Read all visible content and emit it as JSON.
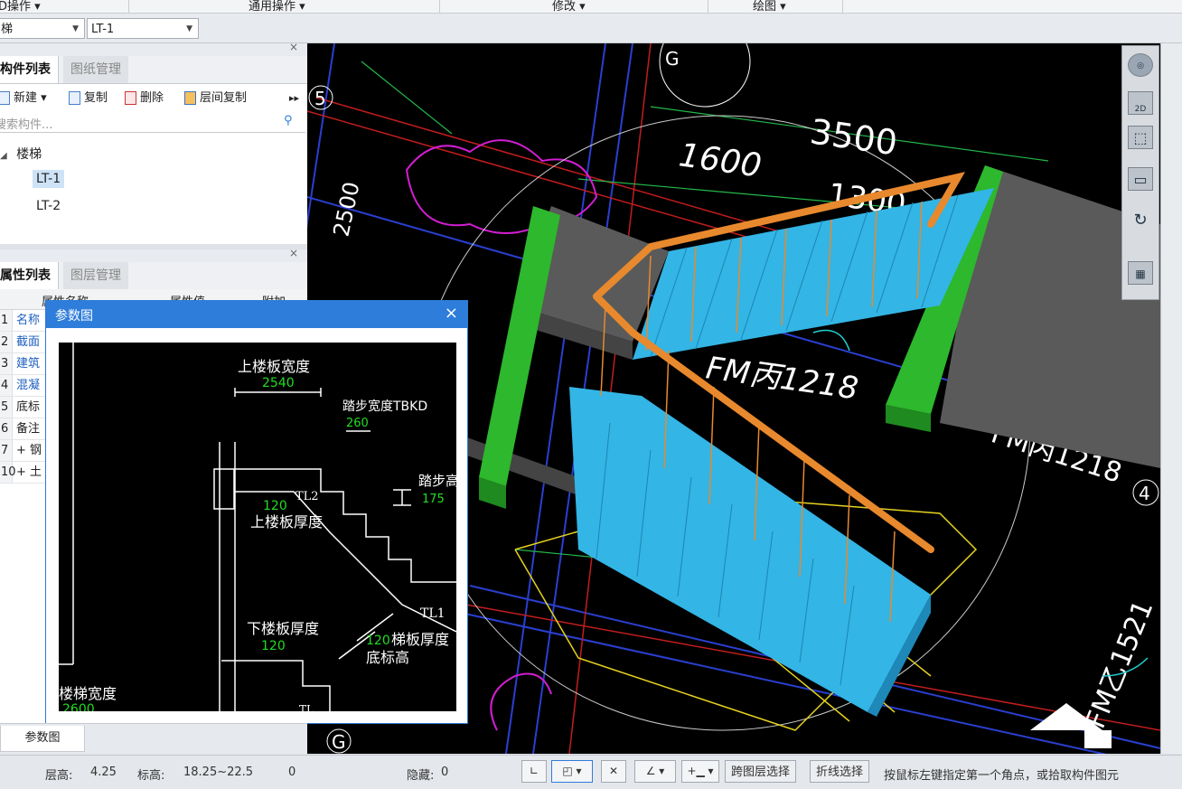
{
  "menubar": {
    "items": [
      "D操作 ▾",
      "通用操作 ▾",
      "修改 ▾",
      "绘图 ▾"
    ]
  },
  "selector": {
    "left_value": "梯",
    "right_value": "LT-1"
  },
  "component_panel": {
    "tabs": [
      "构件列表",
      "图纸管理"
    ],
    "toolbar": [
      "新建 ▾",
      "复制",
      "删除",
      "层间复制"
    ],
    "search_placeholder": "搜索构件...",
    "tree": {
      "group": "楼梯",
      "items": [
        "LT-1",
        "LT-2"
      ]
    }
  },
  "property_panel": {
    "tabs": [
      "属性列表",
      "图层管理"
    ],
    "columns": [
      "属性名称",
      "属性值",
      "附加"
    ],
    "rows": [
      {
        "idx": "1",
        "name": "名称",
        "link": true
      },
      {
        "idx": "2",
        "name": "截面",
        "link": true
      },
      {
        "idx": "3",
        "name": "建筑",
        "link": true
      },
      {
        "idx": "4",
        "name": "混凝",
        "link": true
      },
      {
        "idx": "5",
        "name": "底标",
        "link": false
      },
      {
        "idx": "6",
        "name": "备注",
        "link": false
      },
      {
        "idx": "7",
        "name": "+ 钢",
        "link": false
      },
      {
        "idx": "10",
        "name": "+ 土",
        "link": false
      }
    ]
  },
  "dialog": {
    "title": "参数图",
    "labels": {
      "upper_width": "上楼板宽度",
      "upper_width_val": "2540",
      "step_width": "踏步宽度TBKD",
      "step_width_val": "260",
      "step_height": "踏步高",
      "step_height_val": "175",
      "tl2": "TL2",
      "upper_thick_val": "120",
      "upper_thick": "上楼板厚度",
      "tl1": "TL1",
      "lower_thick": "下楼板厚度",
      "lower_thick_val": "120",
      "slab_thick_val": "120",
      "slab_thick": "梯板厚度",
      "base_elev": "底标高",
      "stair_width": "楼梯宽度",
      "stair_width_val": "2600",
      "tl_bottom": "TL"
    }
  },
  "bottom_tab": "参数图",
  "canvas": {
    "dims": [
      "3500",
      "1600",
      "2500",
      "1300"
    ],
    "axis_labels": [
      "G",
      "5",
      "4",
      "G"
    ],
    "door_labels": [
      "FM丙1218",
      "FM丙1218",
      "FM乙1521"
    ]
  },
  "view_toolbar": [
    "2D"
  ],
  "status": {
    "floor_height_label": "层高:",
    "floor_height": "4.25",
    "elev_label": "标高:",
    "elev": "18.25~22.5",
    "zero": "0",
    "hidden_label": "隐藏:",
    "hidden": "0",
    "btn_cross_layer": "跨图层选择",
    "btn_polyline": "折线选择",
    "hint": "按鼠标左键指定第一个角点，或拾取构件图元"
  },
  "colors": {
    "accent": "#2e7ddb",
    "stair_blue": "#33b5e5",
    "landing_green": "#2db82d",
    "rail_orange": "#e8892e"
  }
}
